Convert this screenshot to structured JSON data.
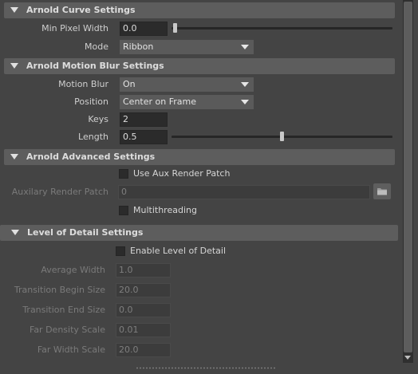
{
  "sections": {
    "curve": {
      "title": "Arnold Curve Settings",
      "min_pixel_width": {
        "label": "Min Pixel Width",
        "value": "0.0",
        "slider_fraction": 0.0
      },
      "mode": {
        "label": "Mode",
        "value": "Ribbon"
      }
    },
    "motion_blur": {
      "title": "Arnold Motion Blur Settings",
      "motion_blur": {
        "label": "Motion Blur",
        "value": "On"
      },
      "position": {
        "label": "Position",
        "value": "Center on Frame"
      },
      "keys": {
        "label": "Keys",
        "value": "2"
      },
      "length": {
        "label": "Length",
        "value": "0.5",
        "slider_fraction": 0.5
      }
    },
    "advanced": {
      "title": "Arnold Advanced Settings",
      "use_aux": {
        "label": "Use Aux Render Patch",
        "checked": false
      },
      "aux_patch": {
        "label": "Auxilary Render Patch",
        "value": "0"
      },
      "multithreading": {
        "label": "Multithreading",
        "checked": false
      }
    },
    "lod": {
      "title": "Level of Detail Settings",
      "enable": {
        "label": "Enable Level of Detail",
        "checked": false
      },
      "average_width": {
        "label": "Average Width",
        "value": "1.0"
      },
      "transition_begin": {
        "label": "Transition Begin Size",
        "value": "20.0"
      },
      "transition_end": {
        "label": "Transition End Size",
        "value": "0.0"
      },
      "far_density": {
        "label": "Far Density Scale",
        "value": "0.01"
      },
      "far_width": {
        "label": "Far Width Scale",
        "value": "20.0"
      }
    }
  },
  "icons": {
    "section_toggle": "triangle-down-icon",
    "dropdown_arrow": "chevron-down-icon",
    "browse": "folder-icon"
  },
  "colors": {
    "panel_bg": "#444444",
    "header_bg": "#5d5d5d",
    "field_bg": "#2b2b2b",
    "dropdown_bg": "#5a5a5a",
    "disabled_text": "#7a7a7a"
  }
}
